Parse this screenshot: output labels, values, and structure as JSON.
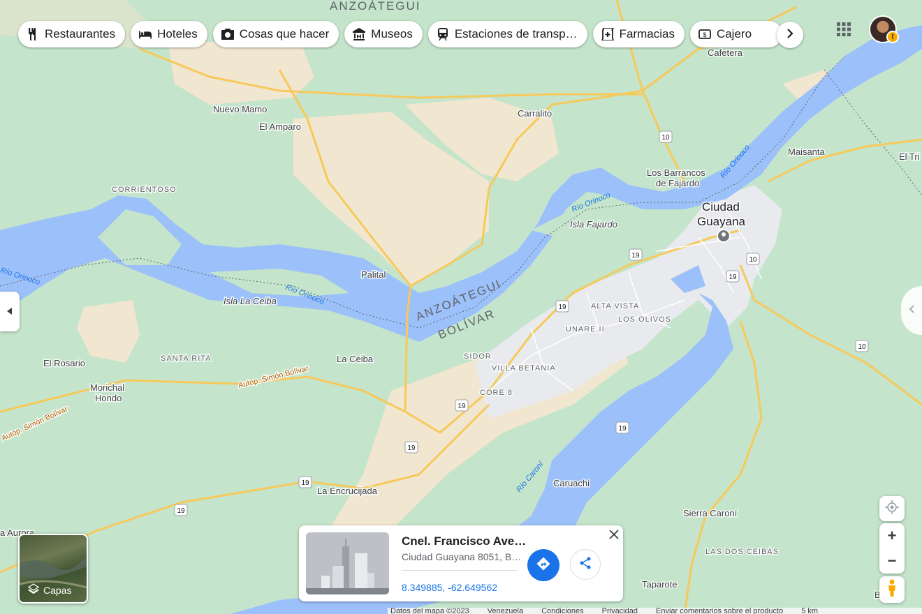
{
  "categories": [
    {
      "label": "Restaurantes",
      "icon": "fork-knife-icon"
    },
    {
      "label": "Hoteles",
      "icon": "bed-icon"
    },
    {
      "label": "Cosas que hacer",
      "icon": "camera-icon"
    },
    {
      "label": "Museos",
      "icon": "museum-icon"
    },
    {
      "label": "Estaciones de transp…",
      "icon": "train-icon"
    },
    {
      "label": "Farmacias",
      "icon": "pharmacy-icon"
    },
    {
      "label": "Cajero",
      "icon": "atm-icon"
    }
  ],
  "map": {
    "places": {
      "ciudad_guayana_1": "Ciudad",
      "ciudad_guayana_2": "Guayana",
      "nuevo_mamo": "Nuevo Mamo",
      "el_amparo": "El Amparo",
      "carralito": "Carralito",
      "cafetera": "Cafetera",
      "maisanta": "Maisanta",
      "el_tri": "El Tri",
      "los_barrancos_1": "Los Barrancos",
      "los_barrancos_2": "de Fajardo",
      "corrientoso": "CORRIENTOSO",
      "palital": "Palital",
      "el_rosario": "El Rosario",
      "santa_rita": "SANTA RITA",
      "la_ceiba": "La Ceiba",
      "morichal_1": "Morichal",
      "morichal_2": "Hondo",
      "alta_vista": "ALTA VISTA",
      "unare": "UNARE II",
      "los_olivos": "LOS OLIVOS",
      "sidor": "SIDOR",
      "villa_betania": "VILLA BETANIA",
      "core8": "CORE 8",
      "caruachi": "Caruachi",
      "la_encrucijada": "La Encrucijada",
      "sierra_caroni": "Sierra Caroní",
      "las_dos_ceibas": "LAS DOS CEIBAS",
      "taparote": "Taparote",
      "la_aurora": "a Aurora",
      "b_retir": "B Retir",
      "anzoategui_top": "ANZOÁTEGUI",
      "anzoategui": "ANZOÁTEGUI",
      "bolivar": "BOLÍVAR"
    },
    "islands": {
      "isla_fajardo": "Isla Fajardo",
      "isla_la_ceiba": "Isla La Ceiba"
    },
    "rivers": {
      "orinoco_1": "Río Orinoco",
      "orinoco_2": "Río Orinoco",
      "orinoco_3": "Río Orinoco",
      "orinoco_4": "Río Orinoco",
      "caroni": "Río Caroní"
    },
    "roads": {
      "autop_1": "Autop. Simón Bolívar",
      "autop_2": "Autop. Simón Bolívar"
    },
    "route_shields": [
      "10",
      "19",
      "19",
      "10",
      "19",
      "19",
      "10",
      "19",
      "19",
      "19",
      "19"
    ]
  },
  "card": {
    "title": "Cnel. Francisco Ave…",
    "address": "Ciudad Guayana 8051, B…",
    "coords": "8.349885, -62.649562"
  },
  "layers": {
    "label": "Capas"
  },
  "footer": {
    "map_data": "Datos del mapa ©2023",
    "country": "Venezuela",
    "terms": "Condiciones",
    "privacy": "Privacidad",
    "feedback": "Enviar comentarios sobre el producto",
    "scale": "5 km"
  },
  "colors": {
    "water": "#9cc0f9",
    "land": "#c4e4cb",
    "sand": "#f1e6d0",
    "urban": "#e8eaed",
    "highway": "#f7c95a",
    "accent": "#1a73e8"
  }
}
